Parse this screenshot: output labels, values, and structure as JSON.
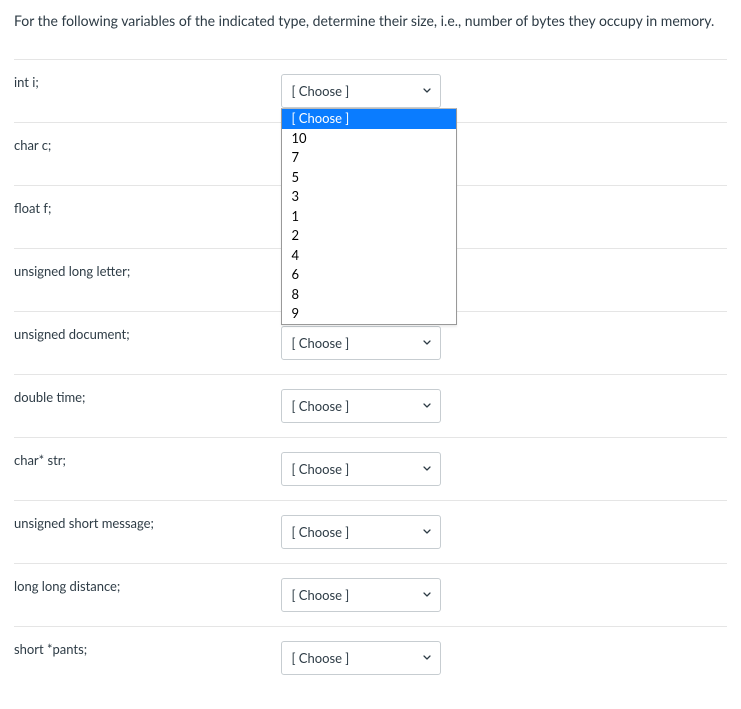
{
  "prompt": "For the following variables of the indicated type, determine their size, i.e., number of bytes they occupy in memory.",
  "select_placeholder": "[ Choose ]",
  "rows": [
    {
      "label": "int i;"
    },
    {
      "label": "char c;"
    },
    {
      "label": "float f;"
    },
    {
      "label": "unsigned long letter;"
    },
    {
      "label": "unsigned document;"
    },
    {
      "label": "double time;"
    },
    {
      "label": "char* str;"
    },
    {
      "label": "unsigned short message;"
    },
    {
      "label": "long long distance;"
    },
    {
      "label": "short *pants;"
    }
  ],
  "dropdown_open_row_index": 0,
  "dropdown_highlight_index": 0,
  "dropdown_options": [
    "[ Choose ]",
    "10",
    "7",
    "5",
    "3",
    "1",
    "2",
    "4",
    "6",
    "8",
    "9"
  ]
}
